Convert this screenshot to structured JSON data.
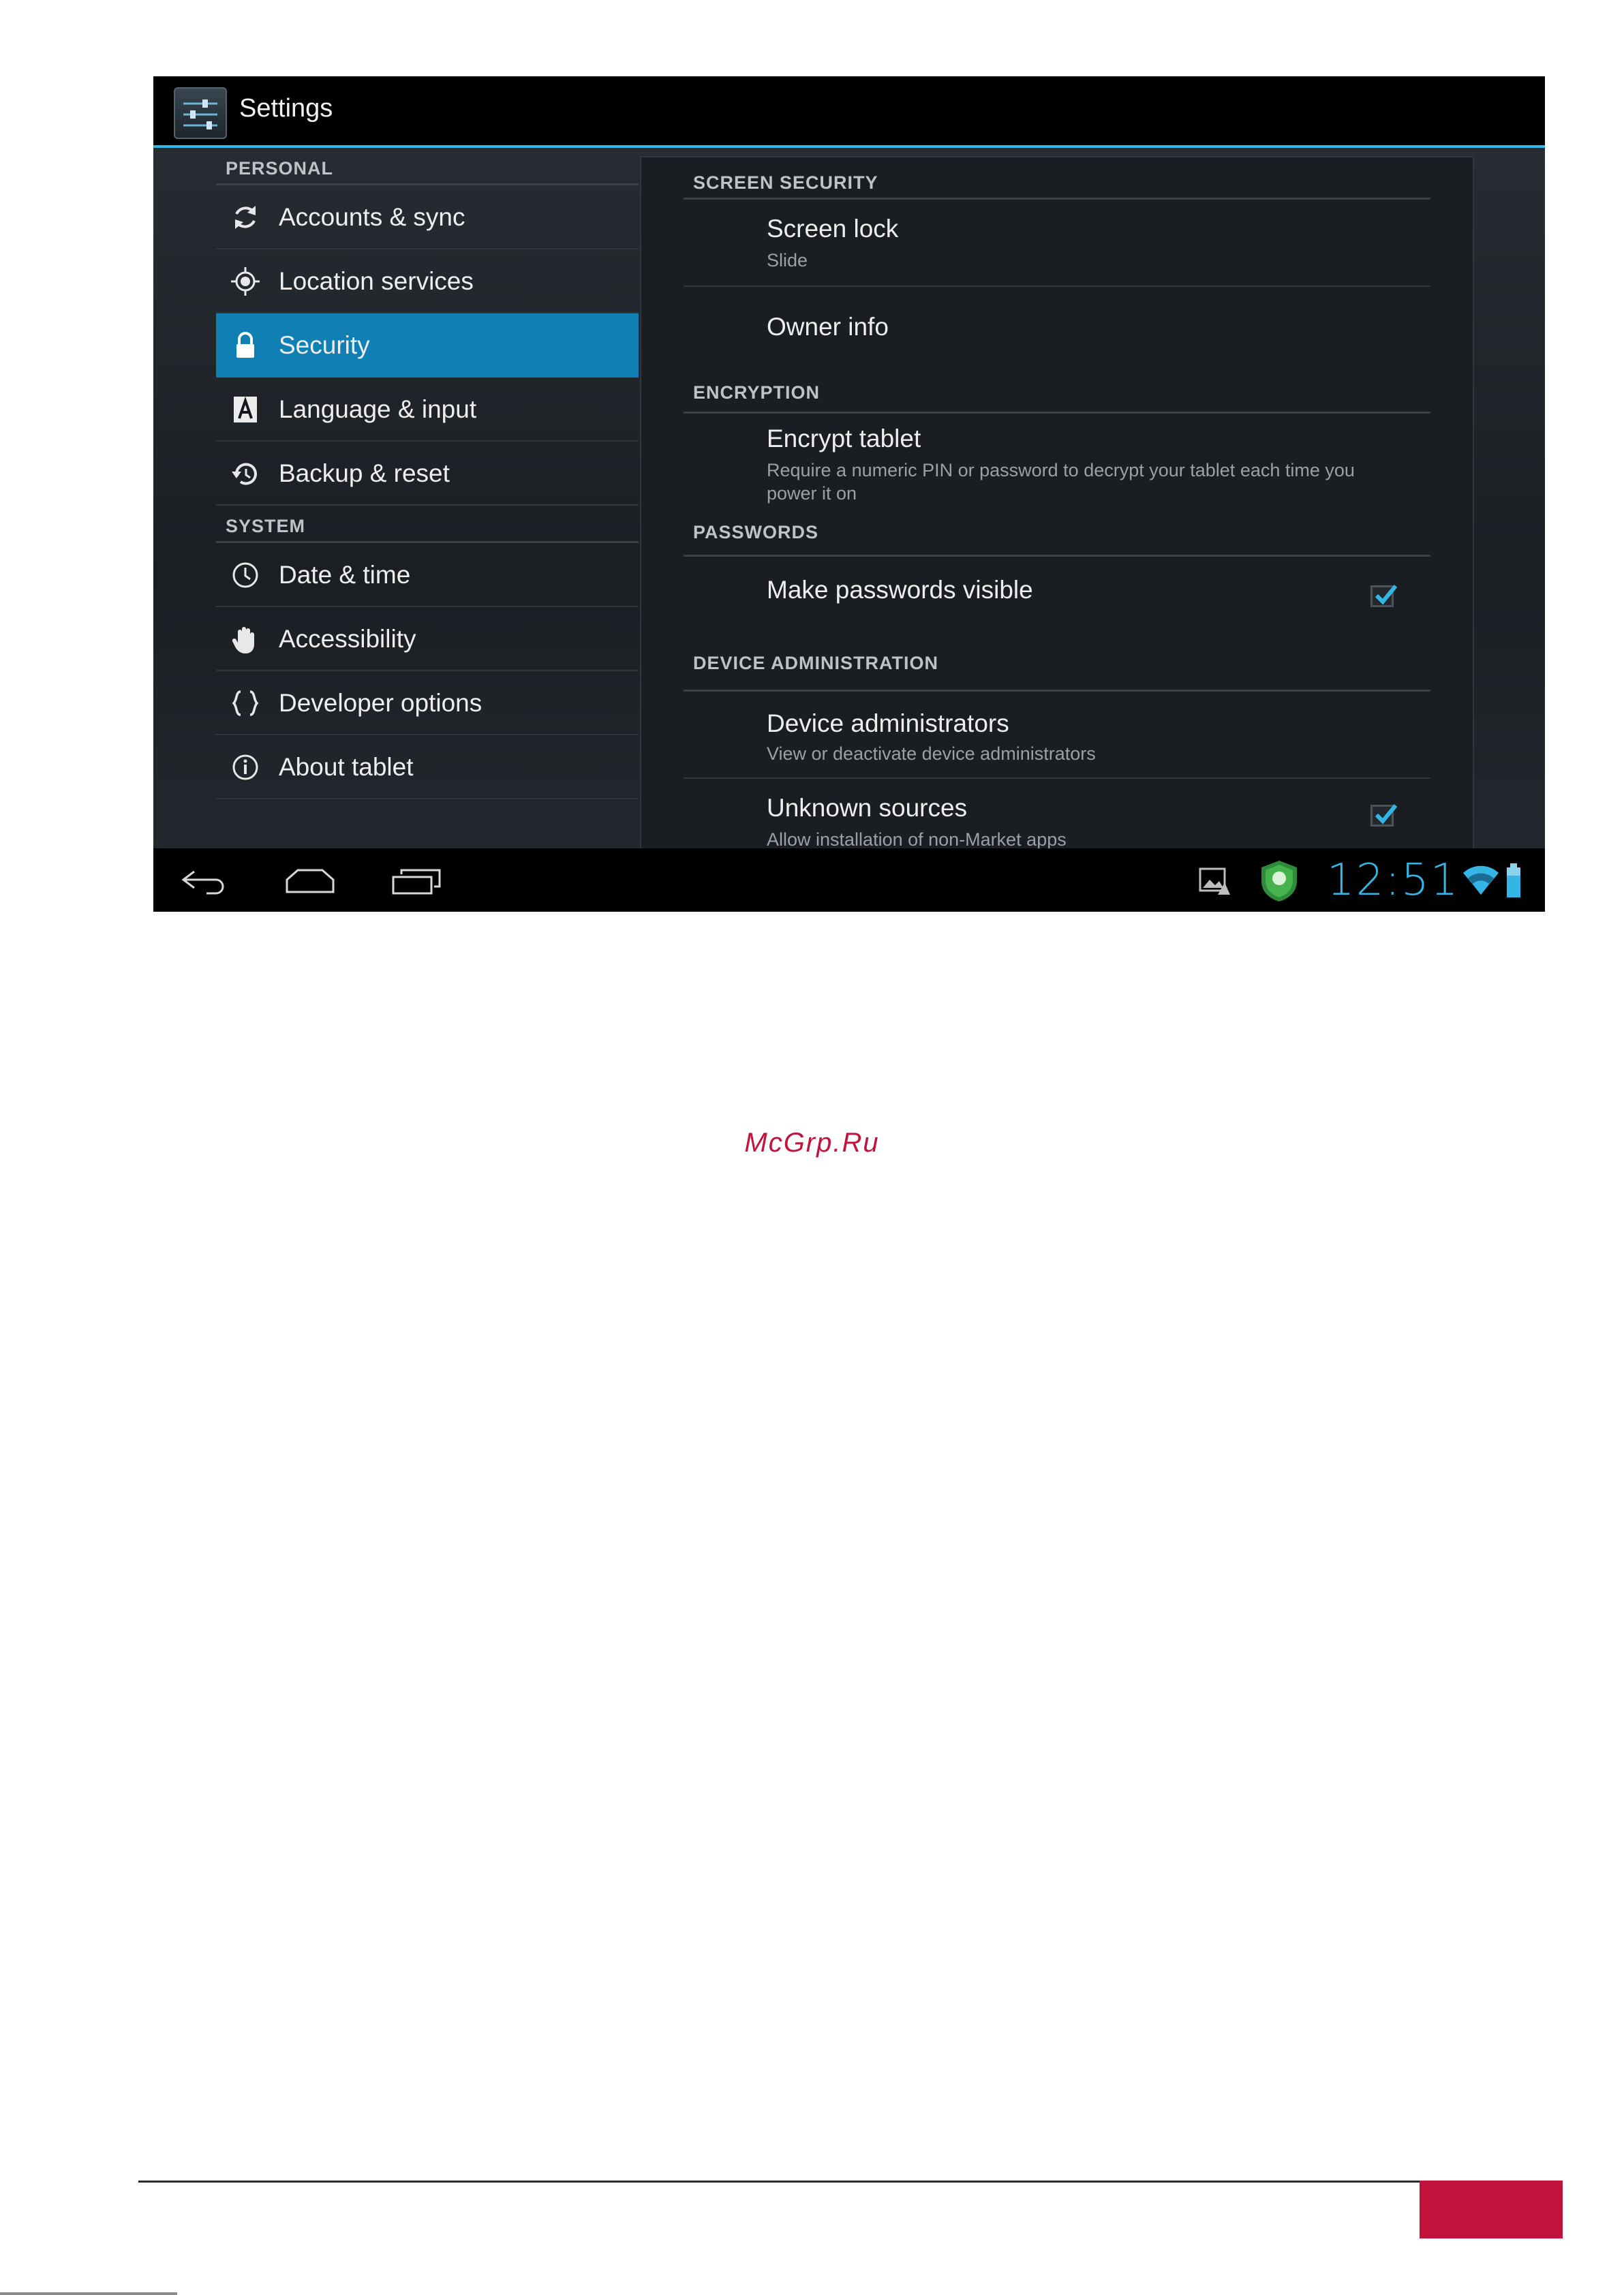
{
  "app": {
    "title": "Settings",
    "icon": "settings-sliders-icon"
  },
  "nav": {
    "personal_header": "PERSONAL",
    "system_header": "SYSTEM",
    "personal_items": [
      {
        "label": "Accounts & sync",
        "icon": "sync-icon"
      },
      {
        "label": "Location services",
        "icon": "location-icon"
      },
      {
        "label": "Security",
        "icon": "lock-icon",
        "selected": true
      },
      {
        "label": "Language & input",
        "icon": "keyboard-a-icon"
      },
      {
        "label": "Backup & reset",
        "icon": "backup-icon"
      }
    ],
    "system_items": [
      {
        "label": "Date & time",
        "icon": "clock-icon"
      },
      {
        "label": "Accessibility",
        "icon": "hand-icon"
      },
      {
        "label": "Developer options",
        "icon": "braces-icon"
      },
      {
        "label": "About tablet",
        "icon": "info-icon"
      }
    ]
  },
  "panel": {
    "screen_security": {
      "header": "SCREEN SECURITY",
      "screen_lock": {
        "title": "Screen lock",
        "summary": "Slide"
      },
      "owner_info": {
        "title": "Owner info"
      }
    },
    "encryption": {
      "header": "ENCRYPTION",
      "encrypt_tablet": {
        "title": "Encrypt tablet",
        "summary": "Require a numeric PIN or password to decrypt your tablet each time you power it on"
      }
    },
    "passwords": {
      "header": "PASSWORDS",
      "make_visible": {
        "title": "Make passwords visible",
        "checked": true
      }
    },
    "device_administration": {
      "header": "DEVICE ADMINISTRATION",
      "device_admins": {
        "title": "Device administrators",
        "summary": "View or deactivate device administrators"
      },
      "unknown_sources": {
        "title": "Unknown sources",
        "summary": "Allow installation of non-Market apps",
        "checked": true
      }
    }
  },
  "statusbar": {
    "time": "12:51"
  },
  "page": {
    "watermark": "McGrp.Ru"
  },
  "colors": {
    "accent": "#33b5e5",
    "selected": "#0f7fb4",
    "brand_red": "#c0143c"
  }
}
